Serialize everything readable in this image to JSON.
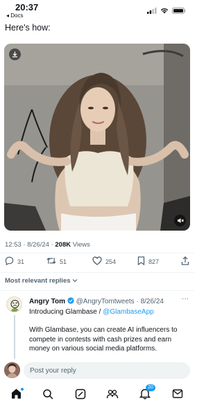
{
  "status": {
    "time": "20:37",
    "back_app": "◂ Docs"
  },
  "post": {
    "text": "Here's how:",
    "meta": {
      "time": "12:53",
      "date": "8/26/24",
      "views_count": "208K",
      "views_label": "Views"
    },
    "actions": {
      "replies": "31",
      "reposts": "51",
      "likes": "254",
      "bookmarks": "827"
    }
  },
  "replies_sort_label": "Most relevant replies",
  "reply": {
    "name": "Angry Tom",
    "handle": "@AngryTomtweets",
    "date": "8/26/24",
    "more": "···",
    "intro": "Introducing Glambase / ",
    "mention": "@GlambaseApp",
    "body": "With Glambase, you can create AI influencers to compete in contests with cash prizes and earn money on various social media platforms."
  },
  "composer": {
    "placeholder": "Post your reply"
  },
  "tabbar": {
    "notifications_badge": "20"
  },
  "colors": {
    "accent": "#1d9bf0",
    "secondary_text": "#536471",
    "verified": "#1d9bf0"
  },
  "icons": [
    "download-icon",
    "mute-icon",
    "reply-icon",
    "repost-icon",
    "like-icon",
    "bookmark-icon",
    "share-icon",
    "home-icon",
    "search-icon",
    "grok-icon",
    "communities-icon",
    "notifications-icon",
    "messages-icon"
  ]
}
